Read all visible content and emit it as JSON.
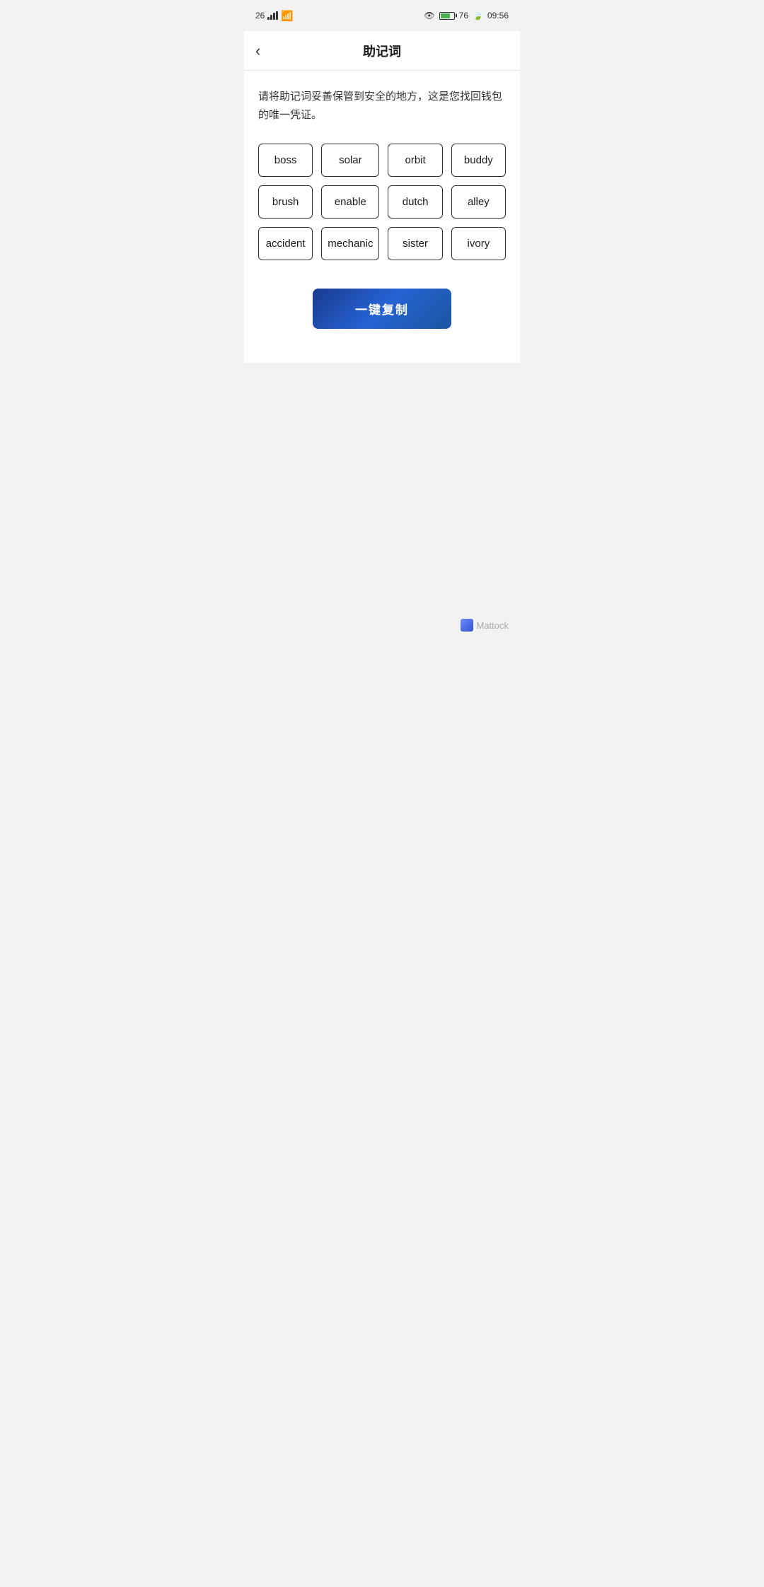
{
  "statusBar": {
    "signal": "26",
    "time": "09:56",
    "battery": "76"
  },
  "header": {
    "title": "助记词",
    "backLabel": "‹"
  },
  "description": "请将助记词妥善保管到安全的地方，这是您找回钱包的唯一凭证。",
  "words": [
    "boss",
    "solar",
    "orbit",
    "buddy",
    "brush",
    "enable",
    "dutch",
    "alley",
    "accident",
    "mechanic",
    "sister",
    "ivory"
  ],
  "copyButton": {
    "label": "一键复制"
  },
  "watermark": "Mattock"
}
